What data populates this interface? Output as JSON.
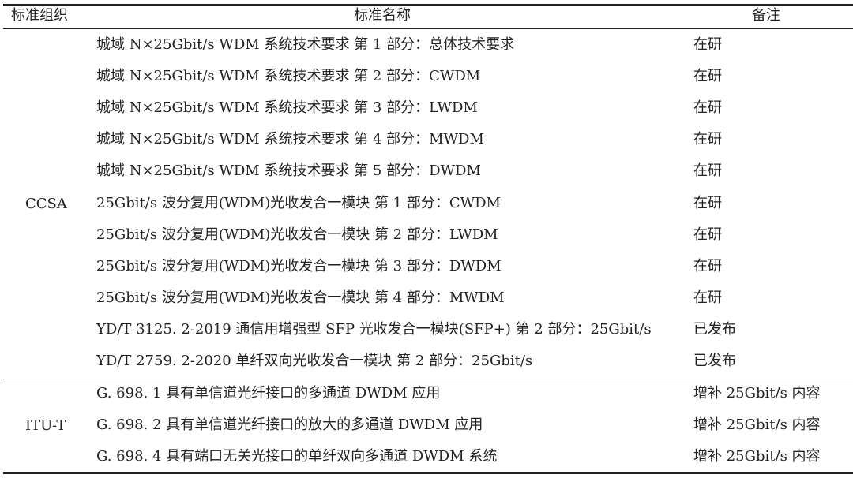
{
  "table": {
    "headers": {
      "org": "标准组织",
      "name": "标准名称",
      "note": "备注"
    },
    "groups": [
      {
        "org": "CCSA",
        "rows": [
          {
            "name": "城域 N×25Gbit/s WDM 系统技术要求 第 1 部分：总体技术要求",
            "note": "在研"
          },
          {
            "name": "城域 N×25Gbit/s WDM 系统技术要求 第 2 部分：CWDM",
            "note": "在研"
          },
          {
            "name": "城域 N×25Gbit/s WDM 系统技术要求 第 3 部分：LWDM",
            "note": "在研"
          },
          {
            "name": "城域 N×25Gbit/s WDM 系统技术要求 第 4 部分：MWDM",
            "note": "在研"
          },
          {
            "name": "城域 N×25Gbit/s WDM 系统技术要求 第 5 部分：DWDM",
            "note": "在研"
          },
          {
            "name": "25Gbit/s 波分复用(WDM)光收发合一模块 第 1 部分：CWDM",
            "note": "在研"
          },
          {
            "name": "25Gbit/s 波分复用(WDM)光收发合一模块 第 2 部分：LWDM",
            "note": "在研"
          },
          {
            "name": "25Gbit/s 波分复用(WDM)光收发合一模块 第 3 部分：DWDM",
            "note": "在研"
          },
          {
            "name": "25Gbit/s 波分复用(WDM)光收发合一模块 第 4 部分：MWDM",
            "note": "在研"
          },
          {
            "name": "YD/T 3125. 2-2019 通信用增强型 SFP 光收发合一模块(SFP+) 第 2 部分：25Gbit/s",
            "note": "已发布"
          },
          {
            "name": "YD/T 2759. 2-2020 单纤双向光收发合一模块 第 2 部分：25Gbit/s",
            "note": "已发布"
          }
        ]
      },
      {
        "org": "ITU-T",
        "rows": [
          {
            "name": "G. 698. 1 具有单信道光纤接口的多通道 DWDM 应用",
            "note": "增补 25Gbit/s 内容"
          },
          {
            "name": "G. 698. 2 具有单信道光纤接口的放大的多通道 DWDM 应用",
            "note": "增补 25Gbit/s 内容"
          },
          {
            "name": "G. 698. 4 具有端口无关光接口的单纤双向多通道 DWDM 系统",
            "note": "增补 25Gbit/s 内容"
          }
        ]
      }
    ]
  }
}
